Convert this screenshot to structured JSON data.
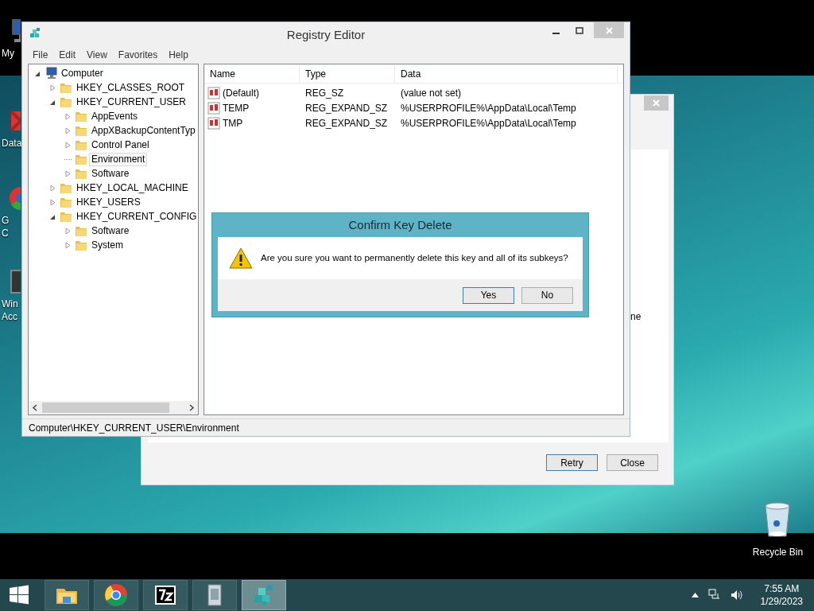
{
  "desktop_icons": [
    {
      "kind": "computer",
      "lines": [
        "My"
      ]
    },
    {
      "kind": "shortcut",
      "lines": [
        "Data"
      ]
    },
    {
      "kind": "browser",
      "lines": [
        "G",
        "C"
      ]
    },
    {
      "kind": "app",
      "lines": [
        "Win",
        "Acc"
      ]
    }
  ],
  "background_window": {
    "text_fragment": "ne",
    "buttons": [
      {
        "label": "Retry",
        "default": true
      },
      {
        "label": "Close",
        "default": false
      }
    ]
  },
  "registry_editor": {
    "title": "Registry Editor",
    "active": false,
    "menu": [
      "File",
      "Edit",
      "View",
      "Favorites",
      "Help"
    ],
    "tree": [
      {
        "label": "Computer",
        "kind": "computer",
        "expandable": true,
        "expanded": true,
        "selected": false,
        "children": [
          {
            "label": "HKEY_CLASSES_ROOT",
            "kind": "folder",
            "expandable": true,
            "expanded": false,
            "selected": false
          },
          {
            "label": "HKEY_CURRENT_USER",
            "kind": "folder",
            "expandable": true,
            "expanded": true,
            "selected": false,
            "children": [
              {
                "label": "AppEvents",
                "kind": "folder",
                "expandable": true,
                "expanded": false,
                "selected": false
              },
              {
                "label": "AppXBackupContentTyp",
                "kind": "folder",
                "expandable": true,
                "expanded": false,
                "selected": false
              },
              {
                "label": "Control Panel",
                "kind": "folder",
                "expandable": true,
                "expanded": false,
                "selected": false
              },
              {
                "label": "Environment",
                "kind": "folder",
                "expandable": false,
                "selected": true
              },
              {
                "label": "Software",
                "kind": "folder",
                "expandable": true,
                "expanded": false,
                "selected": false
              }
            ]
          },
          {
            "label": "HKEY_LOCAL_MACHINE",
            "kind": "folder",
            "expandable": true,
            "expanded": false,
            "selected": false
          },
          {
            "label": "HKEY_USERS",
            "kind": "folder",
            "expandable": true,
            "expanded": false,
            "selected": false
          },
          {
            "label": "HKEY_CURRENT_CONFIG",
            "kind": "folder",
            "expandable": true,
            "expanded": true,
            "selected": false,
            "children": [
              {
                "label": "Software",
                "kind": "folder",
                "expandable": true,
                "expanded": false,
                "selected": false
              },
              {
                "label": "System",
                "kind": "folder",
                "expandable": true,
                "expanded": false,
                "selected": false
              }
            ]
          }
        ]
      }
    ],
    "columns": [
      "Name",
      "Type",
      "Data"
    ],
    "values": [
      {
        "name": "(Default)",
        "type": "REG_SZ",
        "data": "(value not set)"
      },
      {
        "name": "TEMP",
        "type": "REG_EXPAND_SZ",
        "data": "%USERPROFILE%\\AppData\\Local\\Temp"
      },
      {
        "name": "TMP",
        "type": "REG_EXPAND_SZ",
        "data": "%USERPROFILE%\\AppData\\Local\\Temp"
      }
    ],
    "status_bar": "Computer\\HKEY_CURRENT_USER\\Environment"
  },
  "dialog": {
    "title": "Confirm Key Delete",
    "message": "Are you sure you want to permanently delete this key and all of its subkeys?",
    "buttons": [
      {
        "label": "Yes",
        "default": true
      },
      {
        "label": "No",
        "default": false
      }
    ]
  },
  "recycle_bin": {
    "label": "Recycle Bin"
  },
  "taskbar": {
    "apps": [
      {
        "kind": "explorer",
        "active": false
      },
      {
        "kind": "browser",
        "active": false
      },
      {
        "kind": "archiver",
        "active": false
      },
      {
        "kind": "installer",
        "active": false
      },
      {
        "kind": "registry",
        "active": true
      }
    ],
    "time": "7:55 AM",
    "date": "1/29/2023"
  }
}
